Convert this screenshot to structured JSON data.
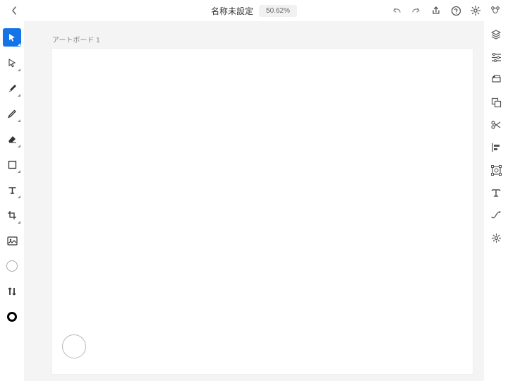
{
  "header": {
    "title": "名称未設定",
    "zoom": "50.62%"
  },
  "artboard": {
    "label": "アートボード 1"
  },
  "colors": {
    "accent": "#1473e6"
  },
  "left_tools": [
    "select",
    "direct-select",
    "pen",
    "pencil",
    "eraser",
    "rectangle",
    "type",
    "crop",
    "image",
    "fill",
    "adjust",
    "stroke"
  ],
  "right_panels": [
    "layers",
    "properties",
    "transform",
    "pathfinder",
    "scissors",
    "align",
    "bounding",
    "type-panel",
    "brush",
    "gear"
  ],
  "top_actions": [
    "undo",
    "redo",
    "share",
    "help",
    "settings",
    "puppet"
  ]
}
